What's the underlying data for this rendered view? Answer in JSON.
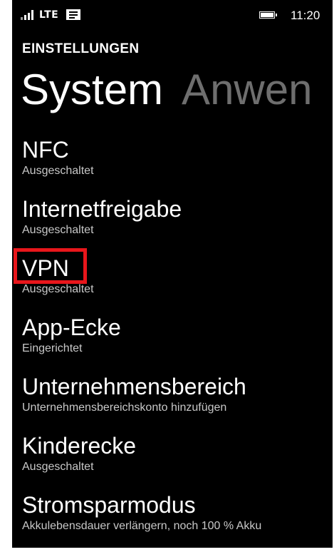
{
  "status_bar": {
    "network": "LTE",
    "time": "11:20"
  },
  "header": {
    "app_title": "EINSTELLUNGEN",
    "tabs": [
      {
        "label": "System",
        "active": true
      },
      {
        "label": "Anwen",
        "active": false
      }
    ]
  },
  "settings": [
    {
      "title": "NFC",
      "subtitle": "Ausgeschaltet"
    },
    {
      "title": "Internetfreigabe",
      "subtitle": "Ausgeschaltet"
    },
    {
      "title": "VPN",
      "subtitle": "Ausgeschaltet",
      "highlighted": true
    },
    {
      "title": "App-Ecke",
      "subtitle": "Eingerichtet"
    },
    {
      "title": "Unternehmensbereich",
      "subtitle": "Unternehmensbereichskonto hinzufügen"
    },
    {
      "title": "Kinderecke",
      "subtitle": "Ausgeschaltet"
    },
    {
      "title": "Stromsparmodus",
      "subtitle": "Akkulebensdauer verlängern, noch 100 % Akku"
    }
  ],
  "icons": [
    "signal-strength-icon",
    "notification-icon",
    "battery-icon"
  ],
  "colors": {
    "background": "#000000",
    "text": "#ffffff",
    "subtext": "#c8c8c8",
    "inactive_tab": "#6e6e6e",
    "highlight": "#e8161b"
  }
}
